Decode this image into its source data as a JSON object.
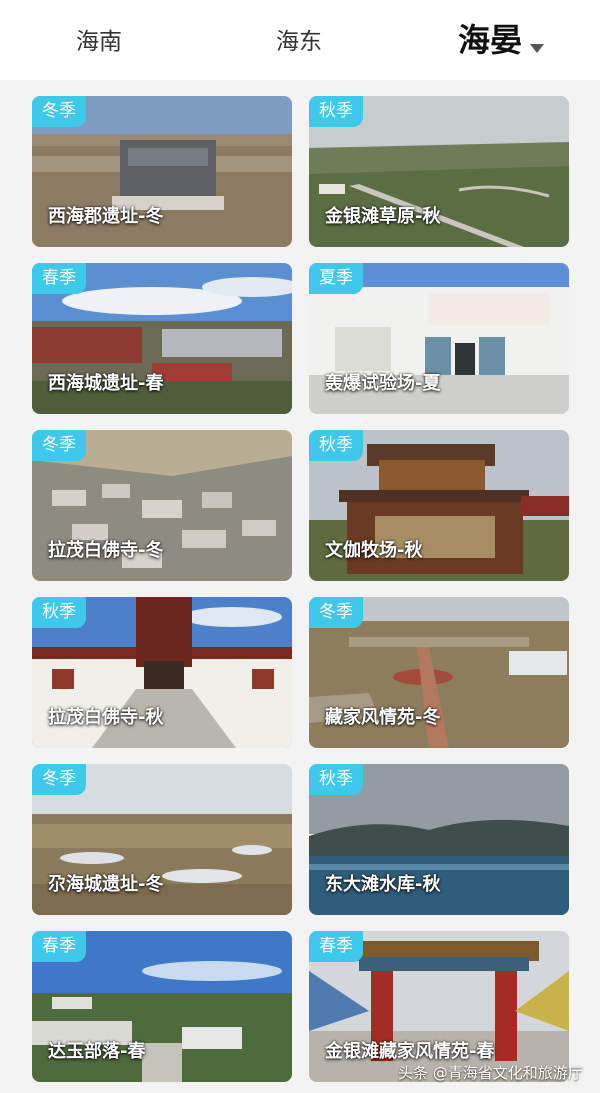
{
  "tabs": [
    {
      "label": "海南"
    },
    {
      "label": "海东"
    },
    {
      "label": "海晏"
    }
  ],
  "cards": [
    {
      "season": "冬季",
      "title": "西海郡遗址-冬",
      "scene": "monument"
    },
    {
      "season": "秋季",
      "title": "金银滩草原-秋",
      "scene": "grassland"
    },
    {
      "season": "春季",
      "title": "西海城遗址-春",
      "scene": "town"
    },
    {
      "season": "夏季",
      "title": "轰爆试验场-夏",
      "scene": "wall"
    },
    {
      "season": "冬季",
      "title": "拉茂白佛寺-冬",
      "scene": "aerial"
    },
    {
      "season": "秋季",
      "title": "文伽牧场-秋",
      "scene": "gate"
    },
    {
      "season": "秋季",
      "title": "拉茂白佛寺-秋",
      "scene": "temple"
    },
    {
      "season": "冬季",
      "title": "藏家风情苑-冬",
      "scene": "plaza"
    },
    {
      "season": "冬季",
      "title": "尕海城遗址-冬",
      "scene": "field"
    },
    {
      "season": "秋季",
      "title": "东大滩水库-秋",
      "scene": "lake"
    },
    {
      "season": "春季",
      "title": "达玉部落-春",
      "scene": "village"
    },
    {
      "season": "春季",
      "title": "金银滩藏家风情苑-春",
      "scene": "archway"
    }
  ],
  "watermark": "头条 @青海省文化和旅游厅",
  "colors": {
    "badge": "#3fc8e9",
    "background": "#f3f3f3",
    "tab_active": "#111111"
  }
}
